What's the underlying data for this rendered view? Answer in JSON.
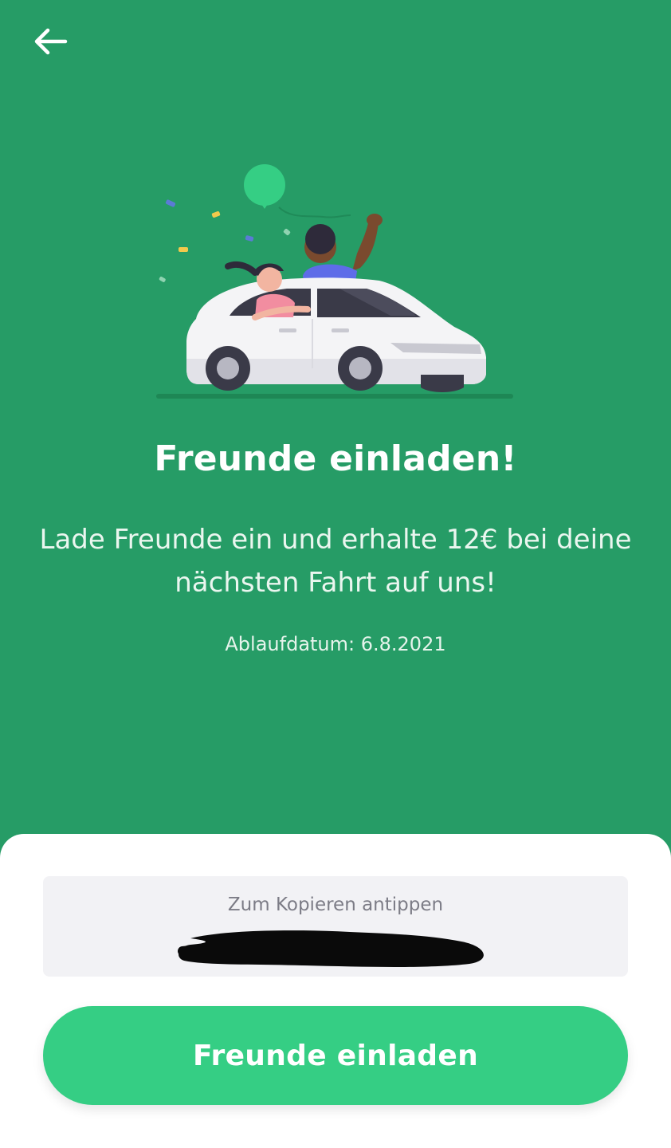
{
  "header": {
    "back_icon": "arrow-left-icon"
  },
  "hero": {
    "background": "#269C66",
    "title": "Freunde einladen!",
    "subtitle": "Lade Freunde ein und erhalte 12€ bei deine nächsten Fahrt auf uns!",
    "expiry": "Ablaufdatum: 6.8.2021"
  },
  "code": {
    "hint": "Zum Kopieren antippen",
    "value_redacted": true
  },
  "cta": {
    "label": "Freunde einladen",
    "color": "#35CE84"
  }
}
